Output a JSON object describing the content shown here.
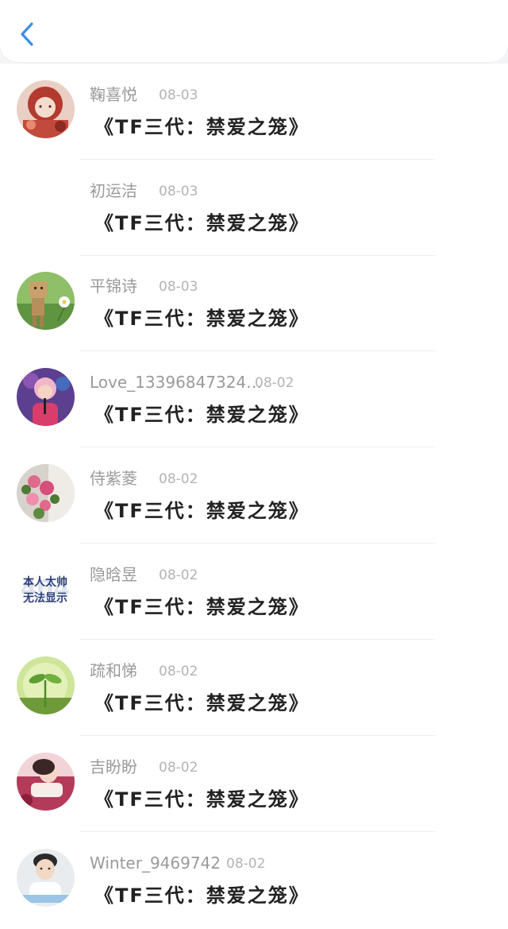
{
  "header": {
    "back_icon": "chevron-left-icon",
    "accent_color": "#3a8ee6"
  },
  "list": {
    "items": [
      {
        "name": "鞠喜悦",
        "date": "08-03",
        "title": "《TF三代：禁爱之笼》",
        "avatar": "avatar-girl-illustration"
      },
      {
        "name": "初运洁",
        "date": "08-03",
        "title": "《TF三代：禁爱之笼》",
        "avatar": "none"
      },
      {
        "name": "平锦诗",
        "date": "08-03",
        "title": "《TF三代：禁爱之笼》",
        "avatar": "avatar-cardboard-robot"
      },
      {
        "name": "Love_13396847324…",
        "date": "08-02",
        "title": "《TF三代：禁爱之笼》",
        "avatar": "avatar-singer-photo"
      },
      {
        "name": "侍紫菱",
        "date": "08-02",
        "title": "《TF三代：禁爱之笼》",
        "avatar": "avatar-flowers"
      },
      {
        "name": "隐晗昱",
        "date": "08-02",
        "title": "《TF三代：禁爱之笼》",
        "avatar": "avatar-text-404",
        "avatar_text_line1": "本人太帅",
        "avatar_text_line2": "无法显示",
        "avatar_bg_text": "404"
      },
      {
        "name": "疏和悌",
        "date": "08-02",
        "title": "《TF三代：禁爱之笼》",
        "avatar": "avatar-green-sprout"
      },
      {
        "name": "吉盼盼",
        "date": "08-02",
        "title": "《TF三代：禁爱之笼》",
        "avatar": "avatar-pink-photo"
      },
      {
        "name": "Winter_9469742",
        "date": "08-02",
        "title": "《TF三代：禁爱之笼》",
        "avatar": "avatar-boy-photo"
      }
    ]
  }
}
